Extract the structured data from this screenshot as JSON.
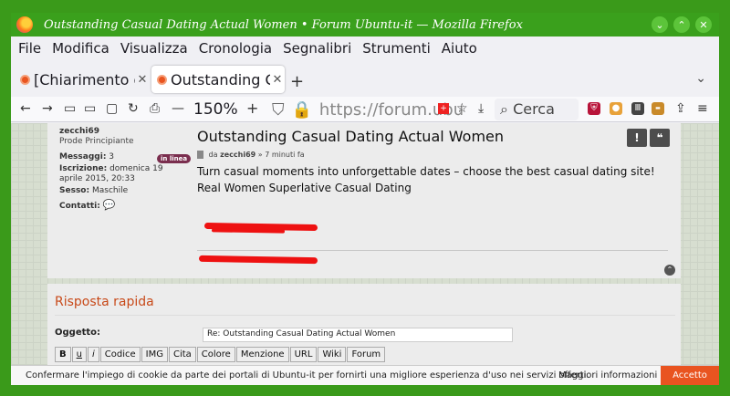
{
  "window": {
    "title": "Outstanding Casual Dating Actual Women • Forum Ubuntu-it — Mozilla Firefox",
    "controls": [
      "minimize",
      "maximize",
      "close"
    ]
  },
  "menu": [
    "File",
    "Modifica",
    "Visualizza",
    "Cronologia",
    "Segnalibri",
    "Strumenti",
    "Aiuto"
  ],
  "tabs": [
    {
      "label": "[Chiarimento d",
      "active": false
    },
    {
      "label": "Outstanding Ca",
      "active": true
    }
  ],
  "nav": {
    "zoom_minus": "—",
    "zoom": "150%",
    "zoom_plus": "+",
    "url": "https://forum.ubu",
    "search_placeholder": "Cerca"
  },
  "post": {
    "author": "zecchi69",
    "rank": "Prode Principiante",
    "online_badge": "in linea",
    "messages_label": "Messaggi:",
    "messages_value": "3",
    "joined_label": "Iscrizione:",
    "joined_value": "domenica 19 aprile 2015, 20:33",
    "sex_label": "Sesso:",
    "sex_value": "Maschile",
    "contacts_label": "Contatti:",
    "title": "Outstanding Casual Dating Actual Women",
    "meta_prefix": "da",
    "meta_author": "zecchi69",
    "meta_suffix": "» 7 minuti fa",
    "body_line1": "Turn casual moments into unforgettable dates – choose the best casual dating site!",
    "body_line2": "Real Women Superlative Casual Dating",
    "report_btn": "!",
    "quote_btn": "❝"
  },
  "reply": {
    "title": "Risposta rapida",
    "subject_label": "Oggetto:",
    "subject_value": "Re: Outstanding Casual Dating Actual Women",
    "format_buttons": [
      "B",
      "u",
      "i",
      "Codice",
      "IMG",
      "Cita",
      "Colore",
      "Menzione",
      "URL",
      "Wiki",
      "Forum"
    ]
  },
  "cookie": {
    "text": "Confermare l'impiego di cookie da parte dei portali di Ubuntu-it per fornirti una migliore esperienza d'uso nei servizi offerti.",
    "more": "Maggiori informazioni",
    "accept": "Accetto"
  },
  "colors": {
    "titlebar": "#3aa01c",
    "accent_orange": "#e95420",
    "online_badge": "#7a2e4e",
    "scribble_red": "#ee1111"
  }
}
